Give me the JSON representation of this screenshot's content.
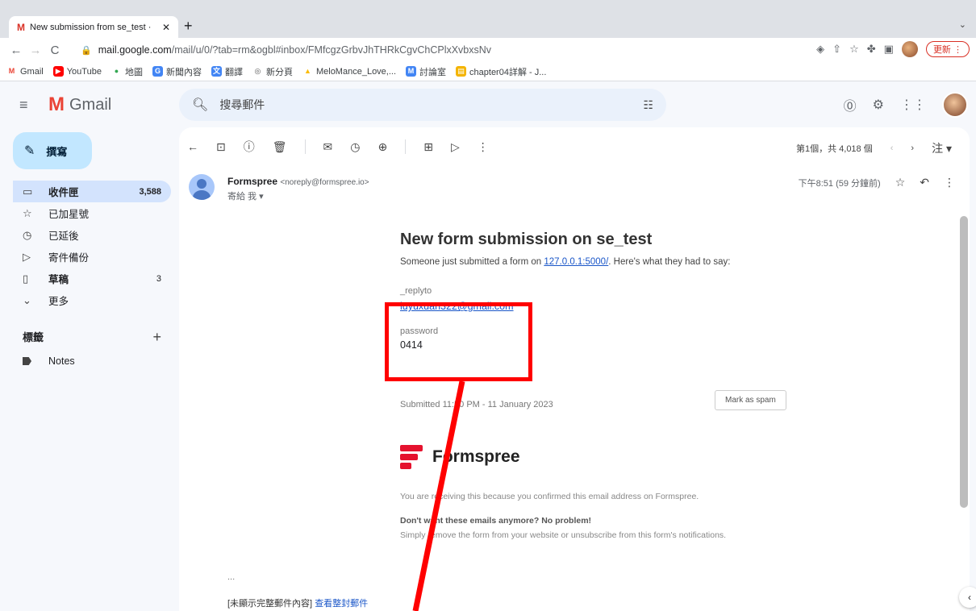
{
  "browser": {
    "tab_title": "New submission from se_test · ",
    "url_host": "mail.google.com",
    "url_path": "/mail/u/0/?tab=rm&ogbl#inbox/FMfcgzGrbvJhTHRkCgvChCPlxXvbxsNv",
    "update_label": "更新",
    "bookmarks": [
      "Gmail",
      "YouTube",
      "地圖",
      "新聞內容",
      "翻譯",
      "新分頁",
      "MeloMance_Love,...",
      "討論室",
      "chapter04詳解 - J..."
    ]
  },
  "gmail": {
    "logo_text": "Gmail",
    "search_placeholder": "搜尋郵件",
    "compose_label": "撰寫",
    "nav": [
      {
        "icon": "inbox-icon",
        "label": "收件匣",
        "count": "3,588",
        "active": true
      },
      {
        "icon": "star-icon",
        "label": "已加星號",
        "count": ""
      },
      {
        "icon": "snooze-icon",
        "label": "已延後",
        "count": ""
      },
      {
        "icon": "send-icon",
        "label": "寄件備份",
        "count": ""
      },
      {
        "icon": "draft-icon",
        "label": "草稿",
        "count": "3"
      },
      {
        "icon": "chevron-down-icon",
        "label": "更多",
        "count": ""
      }
    ],
    "labels_title": "標籤",
    "labels": [
      "Notes"
    ],
    "pager": "第1個，共 4,018 個",
    "lang": "注"
  },
  "message": {
    "sender_name": "Formspree",
    "sender_email": "<noreply@formspree.io>",
    "to_line": "寄給 我 ▾",
    "time": "下午8:51 (59 分鐘前)",
    "heading": "New form submission on se_test",
    "intro_before": "Someone just submitted a form on ",
    "intro_link": "127.0.0.1:5000/",
    "intro_after": ". Here's what they had to say:",
    "field1_label": "_replyto",
    "field1_value": "luyuxuan322@gmail.com",
    "field2_label": "password",
    "field2_value": "0414",
    "submitted": "Submitted 11:50 PM - 11 January 2023",
    "spam_button": "Mark as spam",
    "brand": "Formspree",
    "footer1": "You are receiving this because you confirmed this email address on Formspree.",
    "footer2_bold": "Don't want these emails anymore? No problem!",
    "footer3_before": "Simply remove the form from your website or ",
    "footer3_link": "unsubscribe from this form's notifications",
    "footer3_after": ".",
    "ellipsis": "...",
    "truncated": "[未顯示完整郵件內容]",
    "view_full": "查看整封郵件"
  },
  "colors": {
    "accent_red": "#ff0000",
    "gmail_red": "#ea4335",
    "link": "#1a56c8"
  }
}
